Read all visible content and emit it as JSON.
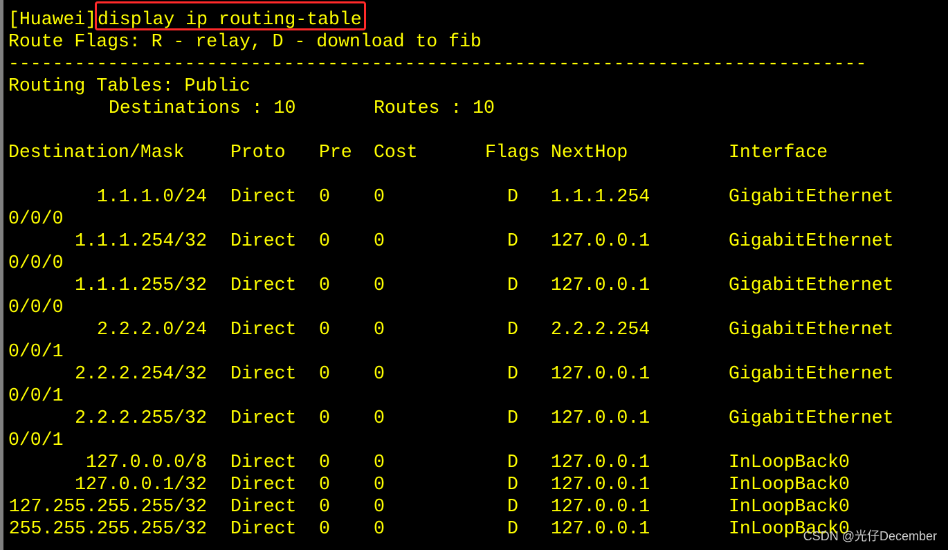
{
  "prompt": "[Huawei]",
  "command": "display ip routing-table",
  "flags_line": "Route Flags: R - relay, D - download to fib",
  "separator": "------------------------------------------------------------------------------",
  "table_title": "Routing Tables: Public",
  "destinations_label": "Destinations : 10",
  "routes_label": "Routes : 10",
  "headers": {
    "destination": "Destination/Mask",
    "proto": "Proto",
    "pre": "Pre",
    "cost": "Cost",
    "flags": "Flags",
    "nexthop": "NextHop",
    "interface": "Interface"
  },
  "routes": [
    {
      "destination": "1.1.1.0/24",
      "proto": "Direct",
      "pre": "0",
      "cost": "0",
      "flags": "D",
      "nexthop": "1.1.1.254",
      "interface": "GigabitEthernet",
      "interface_cont": "0/0/0"
    },
    {
      "destination": "1.1.1.254/32",
      "proto": "Direct",
      "pre": "0",
      "cost": "0",
      "flags": "D",
      "nexthop": "127.0.0.1",
      "interface": "GigabitEthernet",
      "interface_cont": "0/0/0"
    },
    {
      "destination": "1.1.1.255/32",
      "proto": "Direct",
      "pre": "0",
      "cost": "0",
      "flags": "D",
      "nexthop": "127.0.0.1",
      "interface": "GigabitEthernet",
      "interface_cont": "0/0/0"
    },
    {
      "destination": "2.2.2.0/24",
      "proto": "Direct",
      "pre": "0",
      "cost": "0",
      "flags": "D",
      "nexthop": "2.2.2.254",
      "interface": "GigabitEthernet",
      "interface_cont": "0/0/1"
    },
    {
      "destination": "2.2.2.254/32",
      "proto": "Direct",
      "pre": "0",
      "cost": "0",
      "flags": "D",
      "nexthop": "127.0.0.1",
      "interface": "GigabitEthernet",
      "interface_cont": "0/0/1"
    },
    {
      "destination": "2.2.2.255/32",
      "proto": "Direct",
      "pre": "0",
      "cost": "0",
      "flags": "D",
      "nexthop": "127.0.0.1",
      "interface": "GigabitEthernet",
      "interface_cont": "0/0/1"
    },
    {
      "destination": "127.0.0.0/8",
      "proto": "Direct",
      "pre": "0",
      "cost": "0",
      "flags": "D",
      "nexthop": "127.0.0.1",
      "interface": "InLoopBack0"
    },
    {
      "destination": "127.0.0.1/32",
      "proto": "Direct",
      "pre": "0",
      "cost": "0",
      "flags": "D",
      "nexthop": "127.0.0.1",
      "interface": "InLoopBack0"
    },
    {
      "destination": "127.255.255.255/32",
      "proto": "Direct",
      "pre": "0",
      "cost": "0",
      "flags": "D",
      "nexthop": "127.0.0.1",
      "interface": "InLoopBack0"
    },
    {
      "destination": "255.255.255.255/32",
      "proto": "Direct",
      "pre": "0",
      "cost": "0",
      "flags": "D",
      "nexthop": "127.0.0.1",
      "interface": "InLoopBack0"
    }
  ],
  "watermark": "CSDN @光仔December",
  "colors": {
    "text": "#ffff00",
    "background": "#000000",
    "highlight_box": "#ff2a2a"
  }
}
